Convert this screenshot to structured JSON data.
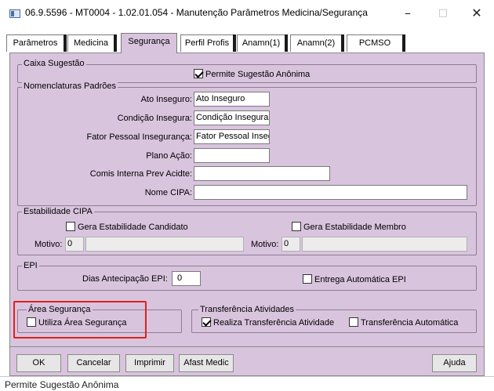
{
  "window": {
    "title": "06.9.5596 - MT0004 - 1.02.01.054 - Manutenção Parâmetros Medicina/Segurança",
    "minimize": "–",
    "maximize": "□",
    "close": "✕"
  },
  "tabs": [
    {
      "label": "Parâmetros"
    },
    {
      "label": "Medicina"
    },
    {
      "label": "Segurança",
      "active": true
    },
    {
      "label": "Perfil Profis"
    },
    {
      "label": "Anamn(1)"
    },
    {
      "label": "Anamn(2)"
    },
    {
      "label": "PCMSO"
    }
  ],
  "caixa_sugestao": {
    "title": "Caixa Sugestão",
    "permite_sugestao_anonima": {
      "label": "Permite Sugestão Anônima",
      "checked": true
    }
  },
  "nomenclaturas": {
    "title": "Nomenclaturas Padrões",
    "fields": [
      {
        "label": "Ato Inseguro:",
        "value": "Ato Inseguro"
      },
      {
        "label": "Condição Insegura:",
        "value": "Condição Insegura"
      },
      {
        "label": "Fator Pessoal Insegurança:",
        "value": "Fator Pessoal Inseg"
      },
      {
        "label": "Plano Ação:",
        "value": ""
      },
      {
        "label": "Comis Interna Prev Acidte:",
        "value": ""
      },
      {
        "label": "Nome CIPA:",
        "value": ""
      }
    ]
  },
  "estabilidade": {
    "title": "Estabilidade CIPA",
    "gera_candidato": {
      "label": "Gera Estabilidade Candidato",
      "checked": false
    },
    "gera_membro": {
      "label": "Gera Estabilidade Membro",
      "checked": false
    },
    "motivo_label": "Motivo:",
    "motivo1_code": "0",
    "motivo2_code": "0"
  },
  "epi": {
    "title": "EPI",
    "dias_label": "Dias Antecipação EPI:",
    "dias_value": "0",
    "entrega_auto": {
      "label": "Entrega Automática EPI",
      "checked": false
    }
  },
  "area_seguranca": {
    "title": "Área Segurança",
    "utiliza": {
      "label": "Utiliza Área Segurança",
      "checked": false
    }
  },
  "transferencia": {
    "title": "Transferência Atividades",
    "realiza": {
      "label": "Realiza Transferência Atividade",
      "checked": true
    },
    "automatica": {
      "label": "Transferência Automática",
      "checked": false
    }
  },
  "buttons": {
    "ok": "OK",
    "cancelar": "Cancelar",
    "imprimir": "Imprimir",
    "afast_medic": "Afast Medic",
    "ajuda": "Ajuda"
  },
  "status": {
    "text": "Permite Sugestão Anônima"
  },
  "colors": {
    "panel": "#d9c4de",
    "highlight": "#e0201c"
  }
}
